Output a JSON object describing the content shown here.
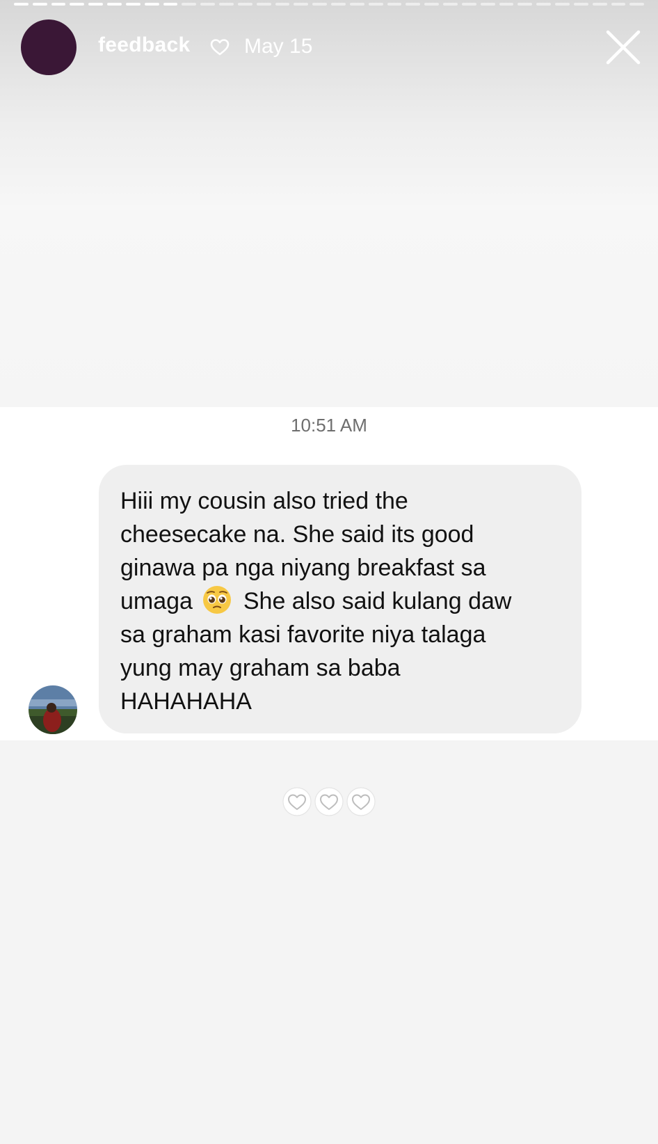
{
  "story": {
    "username": "feedback",
    "date": "May 15",
    "progress_segments_total": 34,
    "progress_segments_done": 9
  },
  "message": {
    "timestamp": "10:51 AM",
    "text_before_emoji": "Hiii my cousin also tried the\ncheesecake na. She said its good\nginawa pa nga niyang breakfast sa\numaga",
    "emoji": "pleading-face",
    "text_after_emoji": "She also said kulang daw\nsa graham kasi favorite niya talaga\nyung may graham sa baba\nHAHAHAHA"
  },
  "reactions": {
    "count": 3,
    "icon": "heart-outline"
  },
  "colors": {
    "profile_avatar": "#3a1736",
    "bubble": "#efefef",
    "text": "#111111"
  }
}
